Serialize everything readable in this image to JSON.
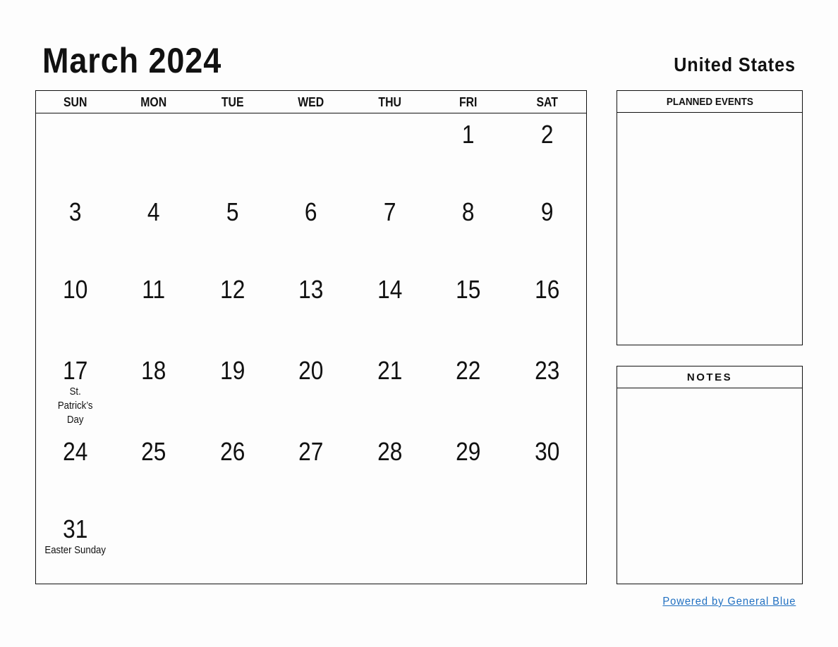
{
  "header": {
    "title": "March 2024",
    "country": "United States"
  },
  "calendar": {
    "weekdays": [
      "SUN",
      "MON",
      "TUE",
      "WED",
      "THU",
      "FRI",
      "SAT"
    ],
    "weeks": [
      [
        {
          "day": ""
        },
        {
          "day": ""
        },
        {
          "day": ""
        },
        {
          "day": ""
        },
        {
          "day": ""
        },
        {
          "day": "1"
        },
        {
          "day": "2"
        }
      ],
      [
        {
          "day": "3"
        },
        {
          "day": "4"
        },
        {
          "day": "5"
        },
        {
          "day": "6"
        },
        {
          "day": "7"
        },
        {
          "day": "8"
        },
        {
          "day": "9"
        }
      ],
      [
        {
          "day": "10"
        },
        {
          "day": "11"
        },
        {
          "day": "12"
        },
        {
          "day": "13"
        },
        {
          "day": "14"
        },
        {
          "day": "15"
        },
        {
          "day": "16"
        }
      ],
      [
        {
          "day": "17",
          "holiday": "St. Patrick’s Day"
        },
        {
          "day": "18"
        },
        {
          "day": "19"
        },
        {
          "day": "20"
        },
        {
          "day": "21"
        },
        {
          "day": "22"
        },
        {
          "day": "23"
        }
      ],
      [
        {
          "day": "24"
        },
        {
          "day": "25"
        },
        {
          "day": "26"
        },
        {
          "day": "27"
        },
        {
          "day": "28"
        },
        {
          "day": "29"
        },
        {
          "day": "30"
        }
      ],
      [
        {
          "day": "31",
          "holiday": "Easter Sunday"
        },
        {
          "day": ""
        },
        {
          "day": ""
        },
        {
          "day": ""
        },
        {
          "day": ""
        },
        {
          "day": ""
        },
        {
          "day": ""
        }
      ]
    ]
  },
  "sidebar": {
    "planned_events_label": "PLANNED EVENTS",
    "notes_label": "NOTES"
  },
  "footer": {
    "powered_by": "Powered by General Blue",
    "link_color": "#1f6fc1"
  }
}
